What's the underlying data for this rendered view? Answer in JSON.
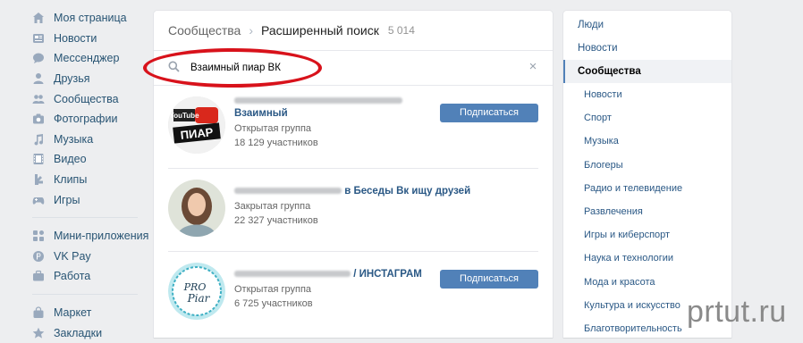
{
  "nav": {
    "main": [
      {
        "label": "Моя страница",
        "icon": "home-icon"
      },
      {
        "label": "Новости",
        "icon": "news-icon"
      },
      {
        "label": "Мессенджер",
        "icon": "messenger-icon"
      },
      {
        "label": "Друзья",
        "icon": "friends-icon"
      },
      {
        "label": "Сообщества",
        "icon": "communities-icon"
      },
      {
        "label": "Фотографии",
        "icon": "camera-icon"
      },
      {
        "label": "Музыка",
        "icon": "music-icon"
      },
      {
        "label": "Видео",
        "icon": "video-icon"
      },
      {
        "label": "Клипы",
        "icon": "clips-icon"
      },
      {
        "label": "Игры",
        "icon": "gamepad-icon"
      }
    ],
    "apps": [
      {
        "label": "Мини-приложения",
        "icon": "apps-icon"
      },
      {
        "label": "VK Pay",
        "icon": "vkpay-icon"
      },
      {
        "label": "Работа",
        "icon": "briefcase-icon"
      }
    ],
    "more": [
      {
        "label": "Маркет",
        "icon": "bag-icon"
      },
      {
        "label": "Закладки",
        "icon": "star-icon"
      }
    ]
  },
  "header": {
    "breadcrumb": "Сообщества",
    "title": "Расширенный поиск",
    "count": "5 014"
  },
  "search": {
    "value": "Взаимный пиар ВК",
    "clear": "×"
  },
  "results": [
    {
      "name": "Взаимный",
      "type": "Открытая группа",
      "members": "18 129 участников",
      "button": "Подписаться",
      "avatar": "youtube-piar-avatar",
      "avatar_text1": "YouTube",
      "avatar_text2": "ПИАР"
    },
    {
      "name": "в Беседы Вк ищу друзей",
      "type": "Закрытая группа",
      "members": "22 327 участников",
      "button": "",
      "avatar": "girl-photo-avatar"
    },
    {
      "name": "/ ИНСТАГРАМ",
      "type": "Открытая группа",
      "members": "6 725 участников",
      "button": "Подписаться",
      "avatar": "pro-piar-avatar",
      "avatar_text1": "PRO",
      "avatar_text2": "Piar"
    }
  ],
  "filters": {
    "top": [
      "Люди",
      "Новости"
    ],
    "active": "Сообщества",
    "sub": [
      "Новости",
      "Спорт",
      "Музыка",
      "Блогеры",
      "Радио и телевидение",
      "Развлечения",
      "Игры и киберспорт",
      "Наука и технологии",
      "Мода и красота",
      "Культура и искусство",
      "Благотворительность"
    ]
  },
  "watermark": "prtut.ru",
  "colors": {
    "accent": "#5181b8",
    "link": "#2a5885",
    "highlight_oval": "#d8121b"
  }
}
